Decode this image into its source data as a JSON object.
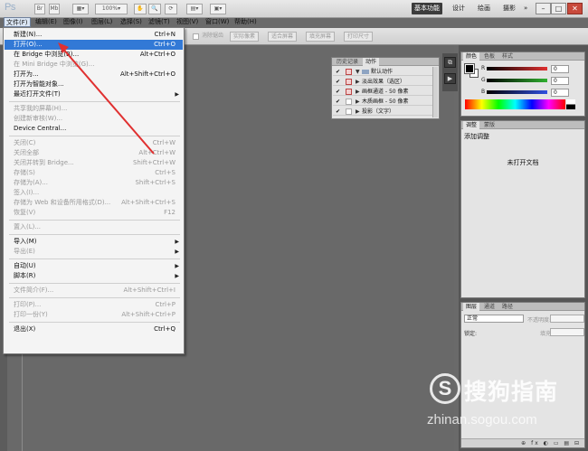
{
  "app": {
    "logo": "Ps",
    "zoom": "100%",
    "workspaces": [
      "基本功能",
      "设计",
      "绘画",
      "摄影"
    ],
    "active_workspace": "基本功能",
    "more": "»"
  },
  "menubar": [
    "文件(F)",
    "编辑(E)",
    "图像(I)",
    "图层(L)",
    "选择(S)",
    "滤镜(T)",
    "视图(V)",
    "窗口(W)",
    "帮助(H)"
  ],
  "options_bar": [
    "消除锯齿",
    "实际像素",
    "适合屏幕",
    "填充屏幕",
    "打印尺寸"
  ],
  "file_menu": [
    {
      "label": "新建(N)...",
      "shortcut": "Ctrl+N",
      "disabled": false
    },
    {
      "label": "打开(O)...",
      "shortcut": "Ctrl+O",
      "disabled": false,
      "highlight": true
    },
    {
      "label": "在 Bridge 中浏览(B)...",
      "shortcut": "Alt+Ctrl+O",
      "disabled": false
    },
    {
      "label": "在 Mini Bridge 中浏览(G)...",
      "shortcut": "",
      "disabled": true
    },
    {
      "label": "打开为...",
      "shortcut": "Alt+Shift+Ctrl+O",
      "disabled": false
    },
    {
      "label": "打开为智能对象...",
      "shortcut": "",
      "disabled": false
    },
    {
      "label": "最近打开文件(T)",
      "shortcut": "",
      "disabled": false,
      "submenu": true
    },
    {
      "sep": true
    },
    {
      "label": "共享我的屏幕(H)...",
      "shortcut": "",
      "disabled": true
    },
    {
      "label": "创建新审核(W)...",
      "shortcut": "",
      "disabled": true
    },
    {
      "label": "Device Central...",
      "shortcut": "",
      "disabled": false
    },
    {
      "sep": true
    },
    {
      "label": "关闭(C)",
      "shortcut": "Ctrl+W",
      "disabled": true
    },
    {
      "label": "关闭全部",
      "shortcut": "Alt+Ctrl+W",
      "disabled": true
    },
    {
      "label": "关闭并转到 Bridge...",
      "shortcut": "Shift+Ctrl+W",
      "disabled": true
    },
    {
      "label": "存储(S)",
      "shortcut": "Ctrl+S",
      "disabled": true
    },
    {
      "label": "存储为(A)...",
      "shortcut": "Shift+Ctrl+S",
      "disabled": true
    },
    {
      "label": "签入(I)...",
      "shortcut": "",
      "disabled": true
    },
    {
      "label": "存储为 Web 和设备所用格式(D)...",
      "shortcut": "Alt+Shift+Ctrl+S",
      "disabled": true
    },
    {
      "label": "恢复(V)",
      "shortcut": "F12",
      "disabled": true
    },
    {
      "sep": true
    },
    {
      "label": "置入(L)...",
      "shortcut": "",
      "disabled": true
    },
    {
      "sep": true
    },
    {
      "label": "导入(M)",
      "shortcut": "",
      "disabled": false,
      "submenu": true
    },
    {
      "label": "导出(E)",
      "shortcut": "",
      "disabled": true,
      "submenu": true
    },
    {
      "sep": true
    },
    {
      "label": "自动(U)",
      "shortcut": "",
      "disabled": false,
      "submenu": true
    },
    {
      "label": "脚本(R)",
      "shortcut": "",
      "disabled": false,
      "submenu": true
    },
    {
      "sep": true
    },
    {
      "label": "文件简介(F)...",
      "shortcut": "Alt+Shift+Ctrl+I",
      "disabled": true
    },
    {
      "sep": true
    },
    {
      "label": "打印(P)...",
      "shortcut": "Ctrl+P",
      "disabled": true
    },
    {
      "label": "打印一份(Y)",
      "shortcut": "Alt+Shift+Ctrl+P",
      "disabled": true
    },
    {
      "sep": true
    },
    {
      "label": "退出(X)",
      "shortcut": "Ctrl+Q",
      "disabled": false
    }
  ],
  "actions_panel": {
    "tabs": [
      "历史记录",
      "动作"
    ],
    "rows": [
      "默认动作",
      "淡出效果（选区）",
      "画框通道 - 50 像素",
      "木质画框 - 50 像素",
      "投影（文字）"
    ]
  },
  "color_panel": {
    "tabs": [
      "颜色",
      "色板",
      "样式"
    ],
    "channels": [
      {
        "name": "R",
        "value": "0",
        "color": "#e03030"
      },
      {
        "name": "G",
        "value": "0",
        "color": "#30b030"
      },
      {
        "name": "B",
        "value": "0",
        "color": "#3050e0"
      }
    ]
  },
  "adjust_panel": {
    "tabs": [
      "调整",
      "蒙版"
    ],
    "title": "添加调整",
    "empty": "未打开文档"
  },
  "layers_panel": {
    "tabs": [
      "图层",
      "通道",
      "路径"
    ],
    "blend_mode": "正常",
    "opacity_label": "不透明度:",
    "lock_label": "锁定:",
    "fill_label": "填充:",
    "footer_icons": "⊕ fx ◐ ▭ ▤ ⊟"
  },
  "watermark": {
    "badge": "S",
    "brand": "搜狗指南",
    "url": "zhinan.sogou.com"
  },
  "annotation_color": "#e03030"
}
